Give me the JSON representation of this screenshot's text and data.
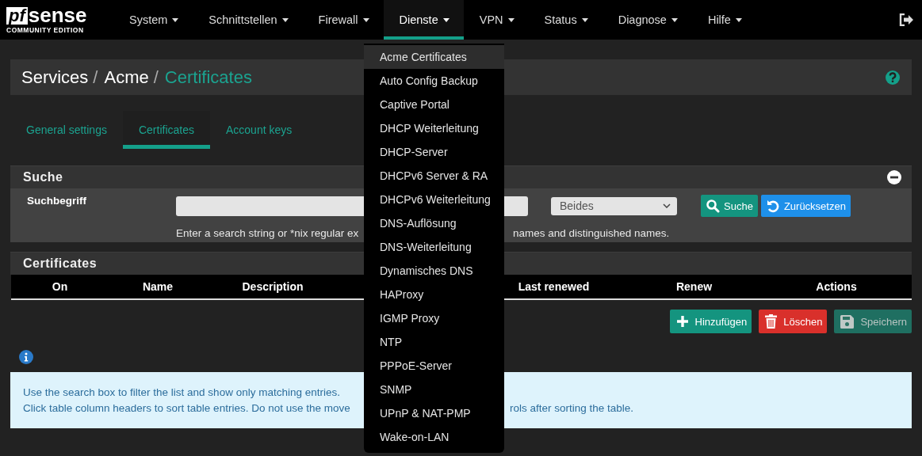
{
  "navbar": {
    "logo": {
      "mark": "pf",
      "name": "sense",
      "edition": "COMMUNITY EDITION"
    },
    "items": [
      {
        "label": "System",
        "selected": false
      },
      {
        "label": "Schnittstellen",
        "selected": false
      },
      {
        "label": "Firewall",
        "selected": false
      },
      {
        "label": "Dienste",
        "selected": true
      },
      {
        "label": "VPN",
        "selected": false
      },
      {
        "label": "Status",
        "selected": false
      },
      {
        "label": "Diagnose",
        "selected": false
      },
      {
        "label": "Hilfe",
        "selected": false
      }
    ]
  },
  "dropdown": {
    "items": [
      {
        "label": "Acme Certificates",
        "selected": true
      },
      {
        "label": "Auto Config Backup",
        "selected": false
      },
      {
        "label": "Captive Portal",
        "selected": false
      },
      {
        "label": "DHCP Weiterleitung",
        "selected": false
      },
      {
        "label": "DHCP-Server",
        "selected": false
      },
      {
        "label": "DHCPv6 Server & RA",
        "selected": false
      },
      {
        "label": "DHCPv6 Weiterleitung",
        "selected": false
      },
      {
        "label": "DNS-Auflösung",
        "selected": false
      },
      {
        "label": "DNS-Weiterleitung",
        "selected": false
      },
      {
        "label": "Dynamisches DNS",
        "selected": false
      },
      {
        "label": "HAProxy",
        "selected": false
      },
      {
        "label": "IGMP Proxy",
        "selected": false
      },
      {
        "label": "NTP",
        "selected": false
      },
      {
        "label": "PPPoE-Server",
        "selected": false
      },
      {
        "label": "SNMP",
        "selected": false
      },
      {
        "label": "UPnP & NAT-PMP",
        "selected": false
      },
      {
        "label": "Wake-on-LAN",
        "selected": false
      }
    ]
  },
  "breadcrumb": [
    {
      "label": "Services",
      "separator": "/"
    },
    {
      "label": "Acme",
      "separator": "/"
    },
    {
      "label": "Certificates"
    }
  ],
  "tabs": [
    {
      "label": "General settings",
      "selected": false
    },
    {
      "label": "Certificates",
      "selected": true
    },
    {
      "label": "Account keys",
      "selected": false
    }
  ],
  "search_panel": {
    "title": "Suche",
    "label": "Suchbegriff",
    "select_value": "Beides",
    "buttons": [
      {
        "kind": "search",
        "label": "Suche"
      },
      {
        "kind": "reset",
        "label": "Zurücksetzen"
      }
    ],
    "hint": [
      "Enter a search string or *nix regular ex",
      "names and distinguished names."
    ]
  },
  "certificates_panel": {
    "title": "Certificates",
    "columns": [
      "On",
      "Name",
      "Description",
      "Last renewed",
      "Renew",
      "Actions"
    ]
  },
  "actions": [
    {
      "kind": "add",
      "label": "Hinzufügen"
    },
    {
      "kind": "delete",
      "label": "Löschen"
    },
    {
      "kind": "save",
      "label": "Speichern"
    }
  ],
  "info": [
    "Use the search box to filter the list and show only matching entries.",
    [
      "Click table column headers to sort table entries. Do not use the move",
      "rols after sorting the table."
    ]
  ]
}
